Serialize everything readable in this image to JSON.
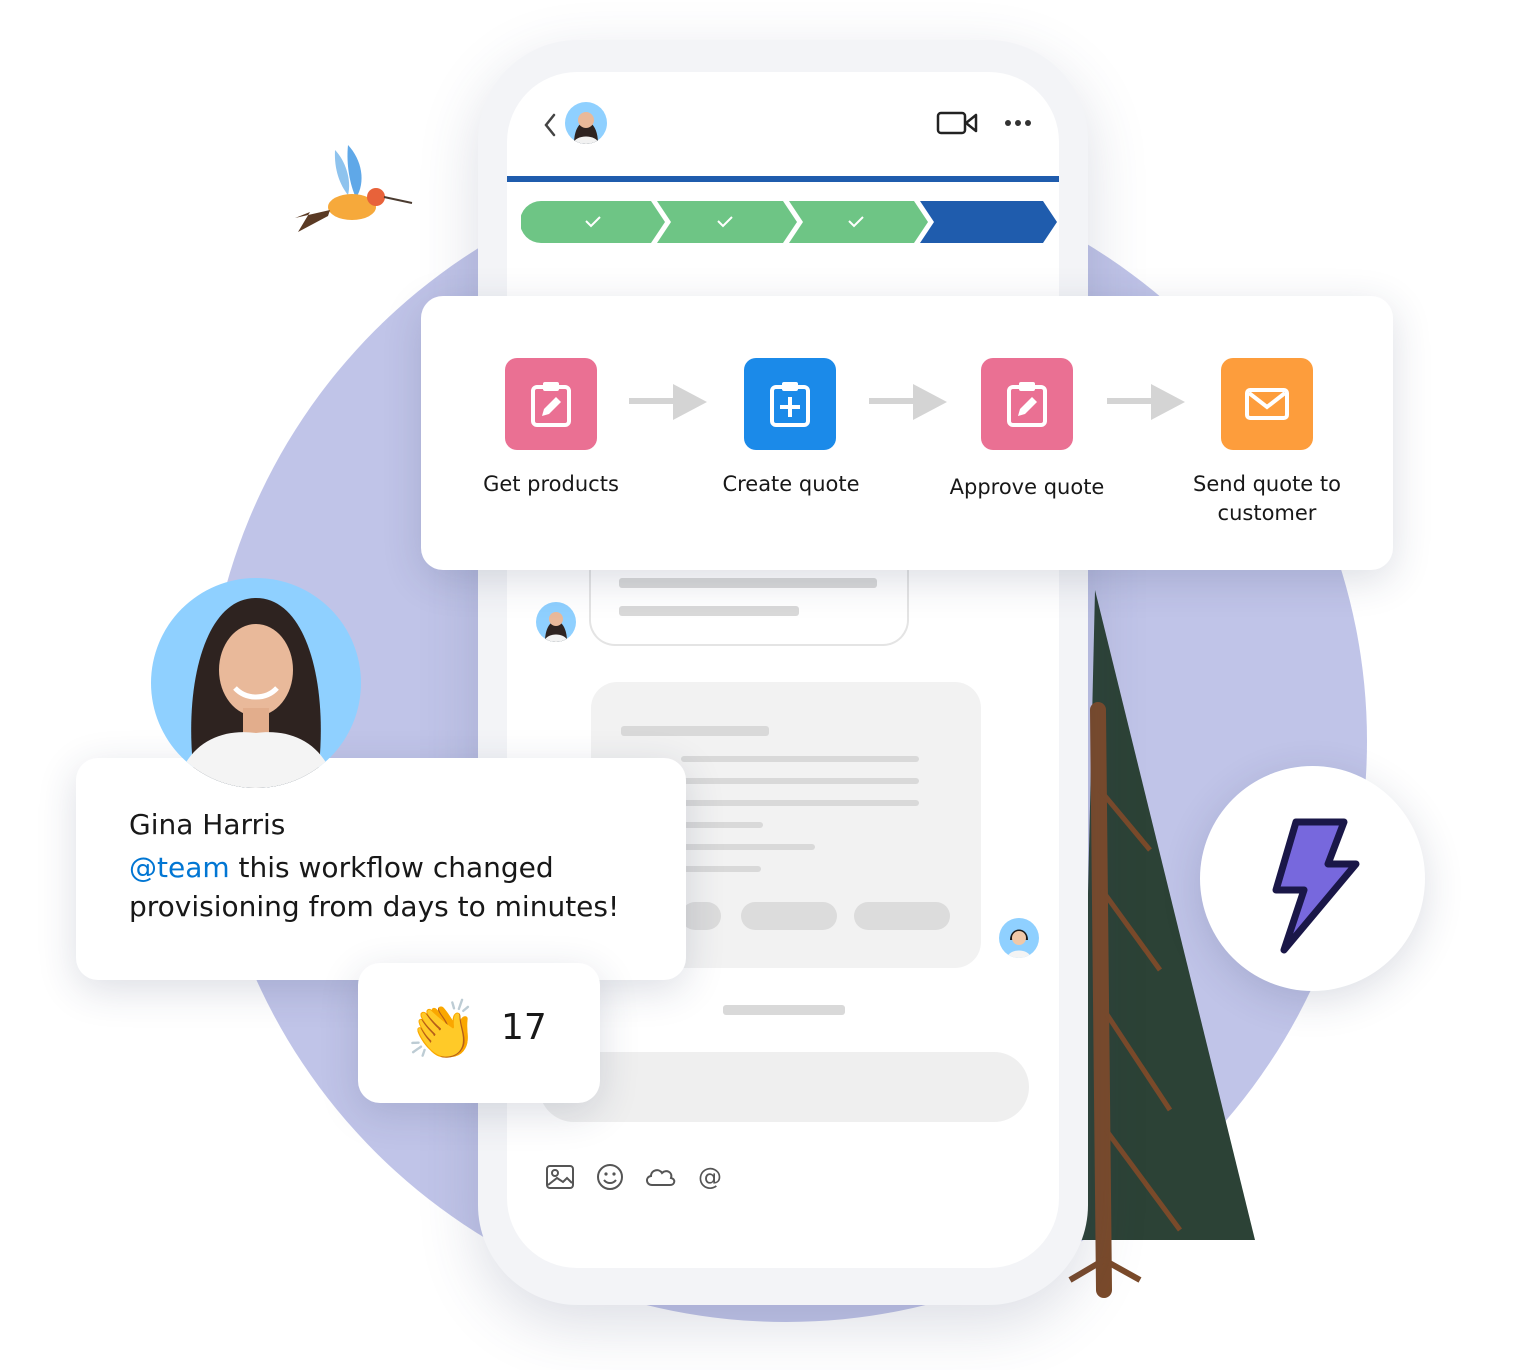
{
  "workflow": {
    "steps": [
      {
        "label": "Get products",
        "icon": "clipboard-edit-icon",
        "color": "#ea7093"
      },
      {
        "label": "Create quote",
        "icon": "clipboard-add-icon",
        "color": "#1b8ae9"
      },
      {
        "label": "Approve quote",
        "icon": "clipboard-edit-icon",
        "color": "#ea7093"
      },
      {
        "label": "Send quote to customer",
        "icon": "envelope-icon",
        "color": "#fd9d3c"
      }
    ]
  },
  "progress_path": {
    "completed_color": "#6ec585",
    "current_color": "#1f5cad",
    "steps_completed": 3,
    "steps_total": 4
  },
  "comment": {
    "author": "Gina Harris",
    "mention": "@team",
    "text": " this workflow changed provisioning from days to minutes!",
    "mention_color": "#0176d3"
  },
  "reaction": {
    "emoji": "👏",
    "count": "17"
  },
  "phone_header": {
    "back_icon": "chevron-left-icon",
    "video_icon": "video-camera-icon",
    "more_icon": "more-dots-icon"
  },
  "composer_icons": [
    "image-icon",
    "emoji-icon",
    "cloud-icon",
    "at-mention-icon"
  ],
  "composer_at_symbol": "@",
  "colors": {
    "header_rule": "#1f5cad",
    "background_circle": "#c0c4e8",
    "lightning": "#7768dd"
  }
}
